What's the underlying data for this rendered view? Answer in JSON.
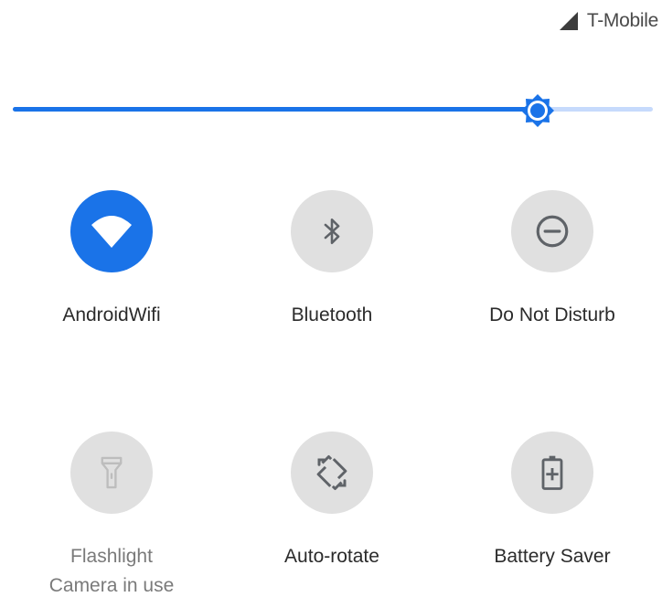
{
  "status_bar": {
    "carrier": "T-Mobile",
    "signal_icon": "cell-signal-icon"
  },
  "brightness": {
    "level_percent": 82,
    "icon": "brightness-icon",
    "colors": {
      "active": "#1a73e8",
      "inactive": "#c6dafc"
    }
  },
  "tiles": [
    {
      "label": "AndroidWifi",
      "icon": "wifi-icon",
      "state": "active"
    },
    {
      "label": "Bluetooth",
      "icon": "bluetooth-icon",
      "state": "inactive"
    },
    {
      "label": "Do Not Disturb",
      "icon": "do-not-disturb-icon",
      "state": "inactive"
    },
    {
      "label": "Flashlight",
      "sublabel": "Camera in use",
      "icon": "flashlight-icon",
      "state": "unavailable"
    },
    {
      "label": "Auto-rotate",
      "icon": "auto-rotate-icon",
      "state": "inactive"
    },
    {
      "label": "Battery Saver",
      "icon": "battery-saver-icon",
      "state": "inactive"
    }
  ],
  "colors": {
    "accent": "#1a73e8",
    "tile_off": "#e0e0e0",
    "icon_off": "#5f6368"
  }
}
